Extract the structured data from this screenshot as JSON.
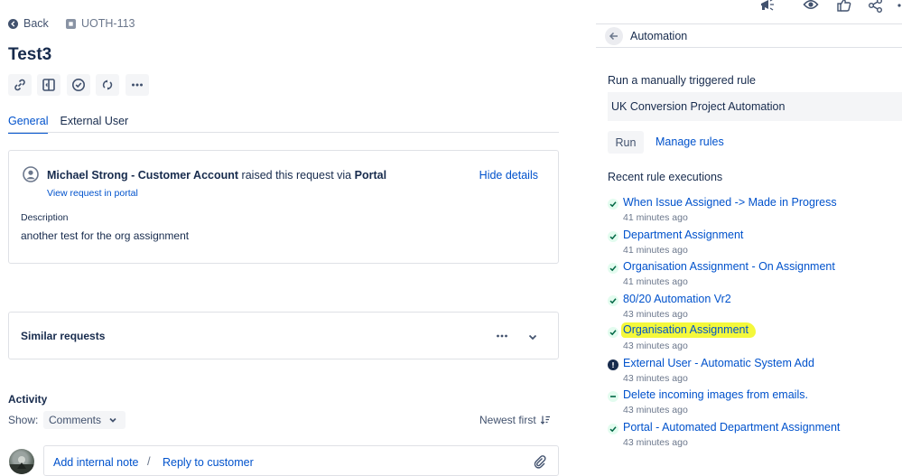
{
  "header": {
    "back_label": "Back",
    "issue_key": "UOTH-113",
    "title": "Test3"
  },
  "toolbar": {
    "icons": [
      "link-icon",
      "split-icon",
      "check-circle-icon",
      "refresh-icon",
      "more-icon"
    ]
  },
  "tabs": [
    {
      "label": "General",
      "active": true
    },
    {
      "label": "External User",
      "active": false
    }
  ],
  "request": {
    "reporter_name": "Michael Strong - Customer Account",
    "raised_text": "raised this request via",
    "channel": "Portal",
    "view_link": "View request in portal",
    "hide_details": "Hide details",
    "description_label": "Description",
    "description": "another test for the org assignment"
  },
  "similar": {
    "title": "Similar requests"
  },
  "activity": {
    "title": "Activity",
    "show_label": "Show:",
    "filter_value": "Comments",
    "sort_label": "Newest first",
    "add_note": "Add internal note",
    "separator": "/",
    "reply": "Reply to customer"
  },
  "automation": {
    "title": "Automation",
    "run_label": "Run a manually triggered rule",
    "selected_rule": "UK Conversion Project Automation",
    "run_button": "Run",
    "manage_rules": "Manage rules",
    "recent_label": "Recent rule executions",
    "executions": [
      {
        "name": "When Issue Assigned -> Made in Progress",
        "time": "41 minutes ago",
        "status": "success"
      },
      {
        "name": "Department Assignment",
        "time": "41 minutes ago",
        "status": "success"
      },
      {
        "name": "Organisation Assignment - On Assignment",
        "time": "41 minutes ago",
        "status": "success"
      },
      {
        "name": "80/20 Automation Vr2",
        "time": "43 minutes ago",
        "status": "success"
      },
      {
        "name": "Organisation Assignment",
        "time": "43 minutes ago",
        "status": "success",
        "highlighted": true
      },
      {
        "name": "External User - Automatic System Add",
        "time": "43 minutes ago",
        "status": "error"
      },
      {
        "name": "Delete incoming images from emails.",
        "time": "43 minutes ago",
        "status": "no-actions"
      },
      {
        "name": "Portal - Automated Department Assignment",
        "time": "43 minutes ago",
        "status": "success"
      }
    ]
  },
  "colors": {
    "link": "#0052cc",
    "text": "#172b4d",
    "success": "#36b37e",
    "highlight": "#f4f83b"
  }
}
